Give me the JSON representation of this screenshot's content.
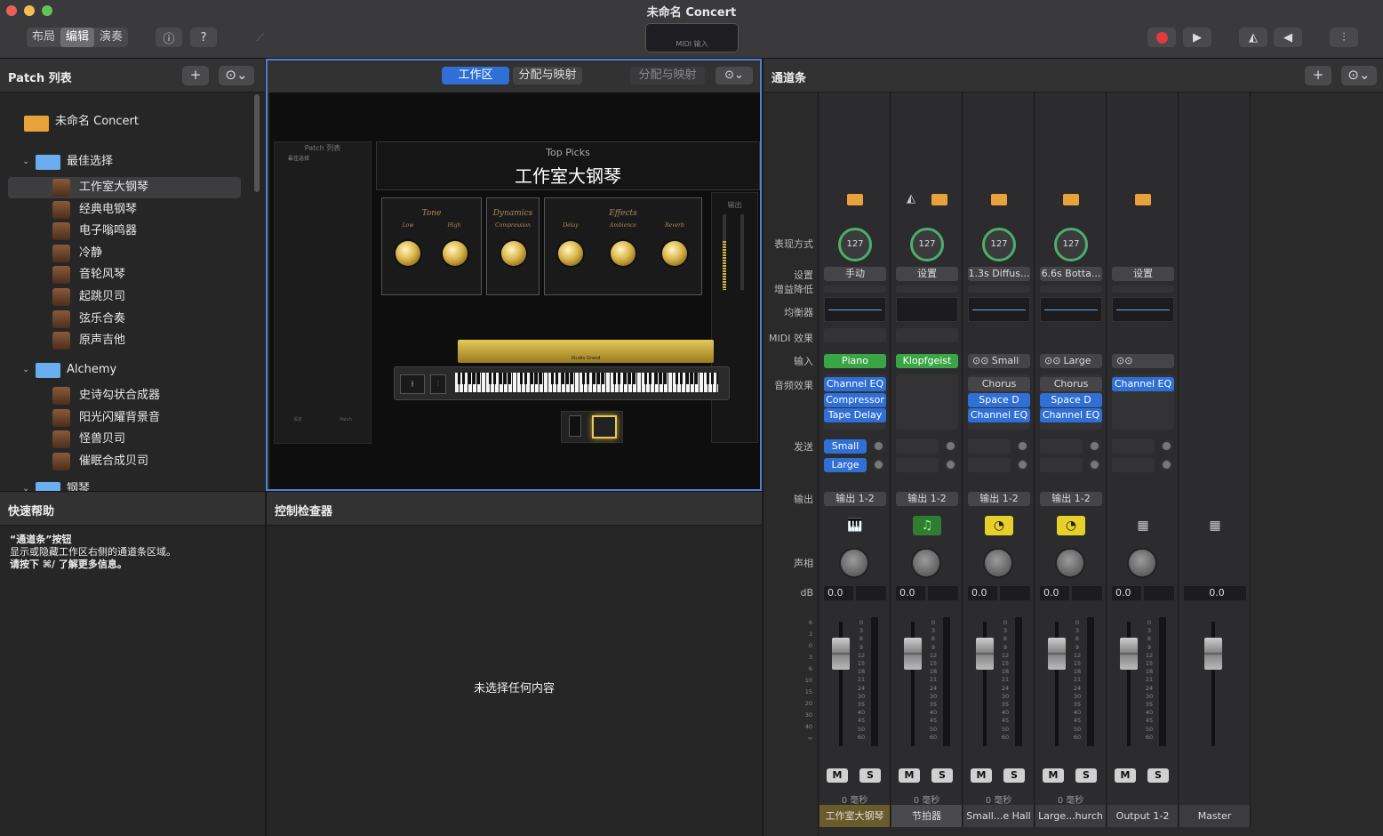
{
  "window": {
    "title": "未命名 Concert"
  },
  "toolbar": {
    "modes": [
      "布局",
      "编辑",
      "演奏"
    ],
    "selected_mode": "编辑",
    "lcd_label": "MIDI 输入"
  },
  "patch_list": {
    "header": "Patch 列表",
    "concert": "未命名 Concert",
    "groups": [
      {
        "name": "最佳选择",
        "items": [
          "工作室大钢琴",
          "经典电钢琴",
          "电子嗡鸣器",
          "冷静",
          "音轮风琴",
          "起跳贝司",
          "弦乐合奏",
          "原声吉他"
        ]
      },
      {
        "name": "Alchemy",
        "items": [
          "史诗勾状合成器",
          "阳光闪耀背景音",
          "怪兽贝司",
          "催眠合成贝司"
        ]
      },
      {
        "name": "钢琴",
        "items": []
      }
    ],
    "selected": "工作室大钢琴"
  },
  "workspace": {
    "tabs": [
      "工作区",
      "分配与映射"
    ],
    "active_tab": "工作区",
    "right_tab": "分配与映射",
    "plugin": {
      "category": "Top Picks",
      "patch": "工作室大钢琴",
      "list_title": "Patch 列表",
      "output_label": "输出",
      "brand": "Studio Grand",
      "sections": [
        {
          "title": "Tone",
          "knobs": [
            "Low",
            "High"
          ]
        },
        {
          "title": "Dynamics",
          "knobs": [
            "Compression"
          ]
        },
        {
          "title": "Effects",
          "knobs": [
            "Delay",
            "Ambience",
            "Reverb"
          ]
        }
      ],
      "mini_list": [
        {
          "t": "最佳选择",
          "g": true
        },
        {
          "t": "工作室大钢琴",
          "s": true
        },
        {
          "t": "经典电钢琴"
        },
        {
          "t": "电子嗡鸣器"
        },
        {
          "t": "冷静"
        },
        {
          "t": "音轮风琴"
        },
        {
          "t": "起跳贝司"
        },
        {
          "t": "弦乐合奏"
        },
        {
          "t": "原声吉他"
        },
        {
          "t": "Alchemy",
          "g": true
        },
        {
          "t": "史诗勾状合成器"
        },
        {
          "t": "阳光闪耀背景音"
        },
        {
          "t": "怪兽贝司"
        },
        {
          "t": "催眠合成贝司"
        },
        {
          "t": "钢琴",
          "g": true
        },
        {
          "t": "Piano & Bass"
        },
        {
          "t": "大钢琴与背景音"
        },
        {
          "t": "大钢琴与弦乐"
        },
        {
          "t": "大钢琴与背景音及合唱"
        },
        {
          "t": "电钢琴",
          "g": true
        },
        {
          "t": "明亮手提箱"
        },
        {
          "t": "经典手提箱 Mk IV"
        },
        {
          "t": "奢华现代"
        },
        {
          "t": "沃立舍经典"
        },
        {
          "t": "沃立舍现代"
        },
        {
          "t": "风琴",
          "g": true
        },
        {
          "t": "经典摇滚风琴"
        },
        {
          "t": "比波普风琴"
        },
        {
          "t": "大风琴"
        }
      ],
      "mini_footer": [
        "设定",
        "Patch"
      ]
    }
  },
  "quick_help": {
    "header": "快速帮助",
    "title": "“通道条”按钮",
    "line1": "显示或隐藏工作区右侧的通道条区域。",
    "line2": "请按下 ⌘/ 了解更多信息。"
  },
  "control_inspector": {
    "header": "控制检查器",
    "empty": "未选择任何内容"
  },
  "channel_strips": {
    "header": "通道条",
    "labels": {
      "display": "表现方式",
      "settings": "设置",
      "gain": "增益降低",
      "eq": "均衡器",
      "midi_fx": "MIDI 效果",
      "input": "输入",
      "audio_fx": "音频效果",
      "sends": "发送",
      "output": "输出",
      "pan": "声相",
      "db": "dB"
    },
    "strips": [
      {
        "name": "工作室大钢琴",
        "gain": "127",
        "setting": "手动",
        "input": "Piano",
        "input_style": "green",
        "fx": [
          "Channel EQ",
          "Compressor",
          "Tape Delay"
        ],
        "sends": [
          "Small",
          "Large"
        ],
        "output": "输出 1-2",
        "db": "0.0",
        "latency": "0 毫秒",
        "ms": [
          "M",
          "S"
        ],
        "icon": "🎹",
        "name_bg": "#6b5a2a"
      },
      {
        "name": "节拍器",
        "gain": "127",
        "setting": "设置",
        "input": "Klopfgeist",
        "input_style": "green",
        "fx": [],
        "sends": [],
        "output": "输出 1-2",
        "db": "0.0",
        "latency": "0 毫秒",
        "ms": [
          "M",
          "S"
        ],
        "icon": "♫",
        "name_bg": "#4a4a4c"
      },
      {
        "name": "Small...e Hall",
        "gain": "127",
        "setting": "1.3s Diffus...",
        "input": "Small",
        "input_style": "link",
        "fx": [
          "Chorus",
          "Space D",
          "Channel EQ"
        ],
        "sends": [],
        "output": "输出 1-2",
        "db": "0.0",
        "latency": "0 毫秒",
        "ms": [
          "M",
          "S"
        ],
        "icon": "◔",
        "name_bg": "#3c3c3e"
      },
      {
        "name": "Large...hurch",
        "gain": "127",
        "setting": "6.6s Botta...",
        "input": "Large",
        "input_style": "link",
        "fx": [
          "Chorus",
          "Space D",
          "Channel EQ"
        ],
        "sends": [],
        "output": "输出 1-2",
        "db": "0.0",
        "latency": "0 毫秒",
        "ms": [
          "M",
          "S"
        ],
        "icon": "◔",
        "name_bg": "#3c3c3e"
      },
      {
        "name": "Output 1-2",
        "gain": "",
        "setting": "设置",
        "input": "",
        "input_style": "link",
        "fx": [
          "Channel EQ"
        ],
        "sends": [],
        "output": "",
        "db": "0.0",
        "latency": "",
        "ms": [
          "M",
          "S"
        ],
        "icon": "▦",
        "name_bg": "#3c3c3e"
      },
      {
        "name": "Master",
        "gain": "",
        "setting": "",
        "input": "",
        "input_style": "none",
        "fx": [],
        "sends": [],
        "output": "",
        "db": "0.0",
        "latency": "",
        "ms": [],
        "icon": "▦",
        "name_bg": "#3c3c3e"
      }
    ],
    "fader_scale": [
      "6",
      "3",
      "0",
      "3",
      "6",
      "10",
      "15",
      "20",
      "30",
      "40",
      "∞"
    ],
    "meter_scale": [
      "0",
      "3",
      "6",
      "9",
      "12",
      "15",
      "18",
      "21",
      "24",
      "30",
      "35",
      "40",
      "45",
      "50",
      "60"
    ]
  },
  "colors": {
    "accent": "#2f6fd6",
    "record": "#e23b3b",
    "green_knob": "#4caf6a",
    "selection": "#4f7fd6"
  }
}
